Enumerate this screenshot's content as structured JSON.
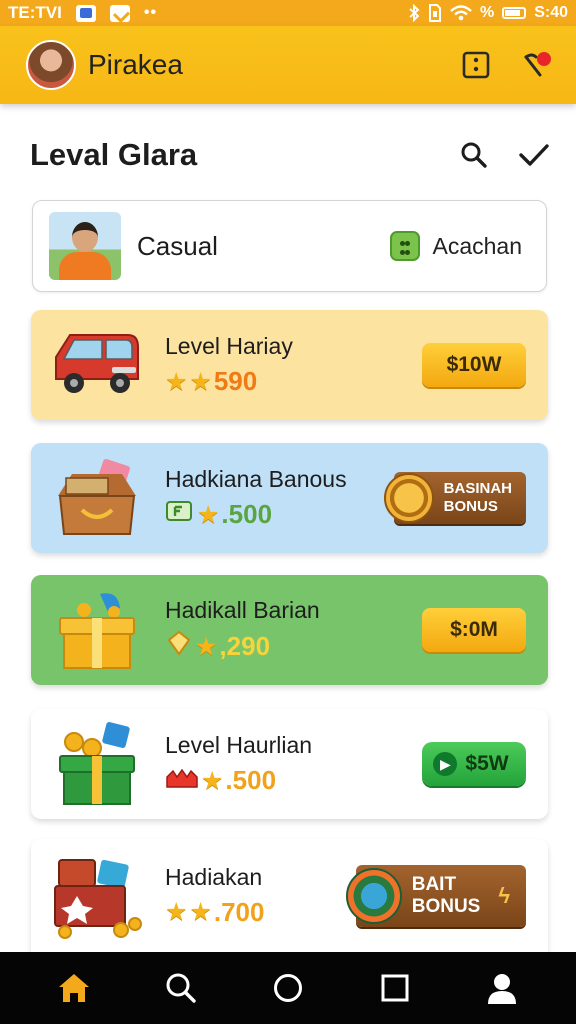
{
  "status_bar": {
    "carrier": "TE:TVI",
    "battery": "%",
    "time": "S:40"
  },
  "app_bar": {
    "title": "Pirakea"
  },
  "page": {
    "title": "Leval Glara"
  },
  "filter": {
    "label": "Casual",
    "right_label": "Acachan"
  },
  "cards": [
    {
      "name": "Level Hariay",
      "rating_value": "590",
      "action": "$10W",
      "bg": "#fde3a0",
      "value_color": "#f07a16"
    },
    {
      "name": "Hadkiana Banous",
      "rating_value": ".500",
      "action_line1": "BASINAH",
      "action_line2": "BONUS",
      "bg": "#bfe0f7",
      "value_color": "#5aa541"
    },
    {
      "name": "Hadikall Barian",
      "rating_value": ",290",
      "action": "$:0M",
      "bg": "#78c46a",
      "value_color": "#f7d43a"
    },
    {
      "name": "Level Haurlian",
      "rating_value": ".500",
      "action": "$5W",
      "bg": "#ffffff",
      "value_color": "#f0a21b"
    },
    {
      "name": "Hadiakan",
      "rating_value": ".700",
      "action_line1": "BAIT",
      "action_line2": "BONUS",
      "bg": "#ffffff",
      "value_color": "#f0a21b"
    }
  ],
  "icons": {
    "status": [
      "square-icon",
      "check-square-icon",
      "bluetooth-icon",
      "sim-icon",
      "wifi-icon",
      "battery-icon"
    ],
    "app_bar": [
      "avatar",
      "menu-dots-icon",
      "pin-icon"
    ],
    "header": [
      "search-icon",
      "check-icon"
    ],
    "bottom_nav": [
      "home-icon",
      "search-icon",
      "circle-icon",
      "square-icon",
      "profile-icon"
    ]
  },
  "colors": {
    "status_bar": "#f4a81c",
    "app_bar": "#f9c21b",
    "accent": "#f3a810",
    "nav_bg": "#050505"
  }
}
